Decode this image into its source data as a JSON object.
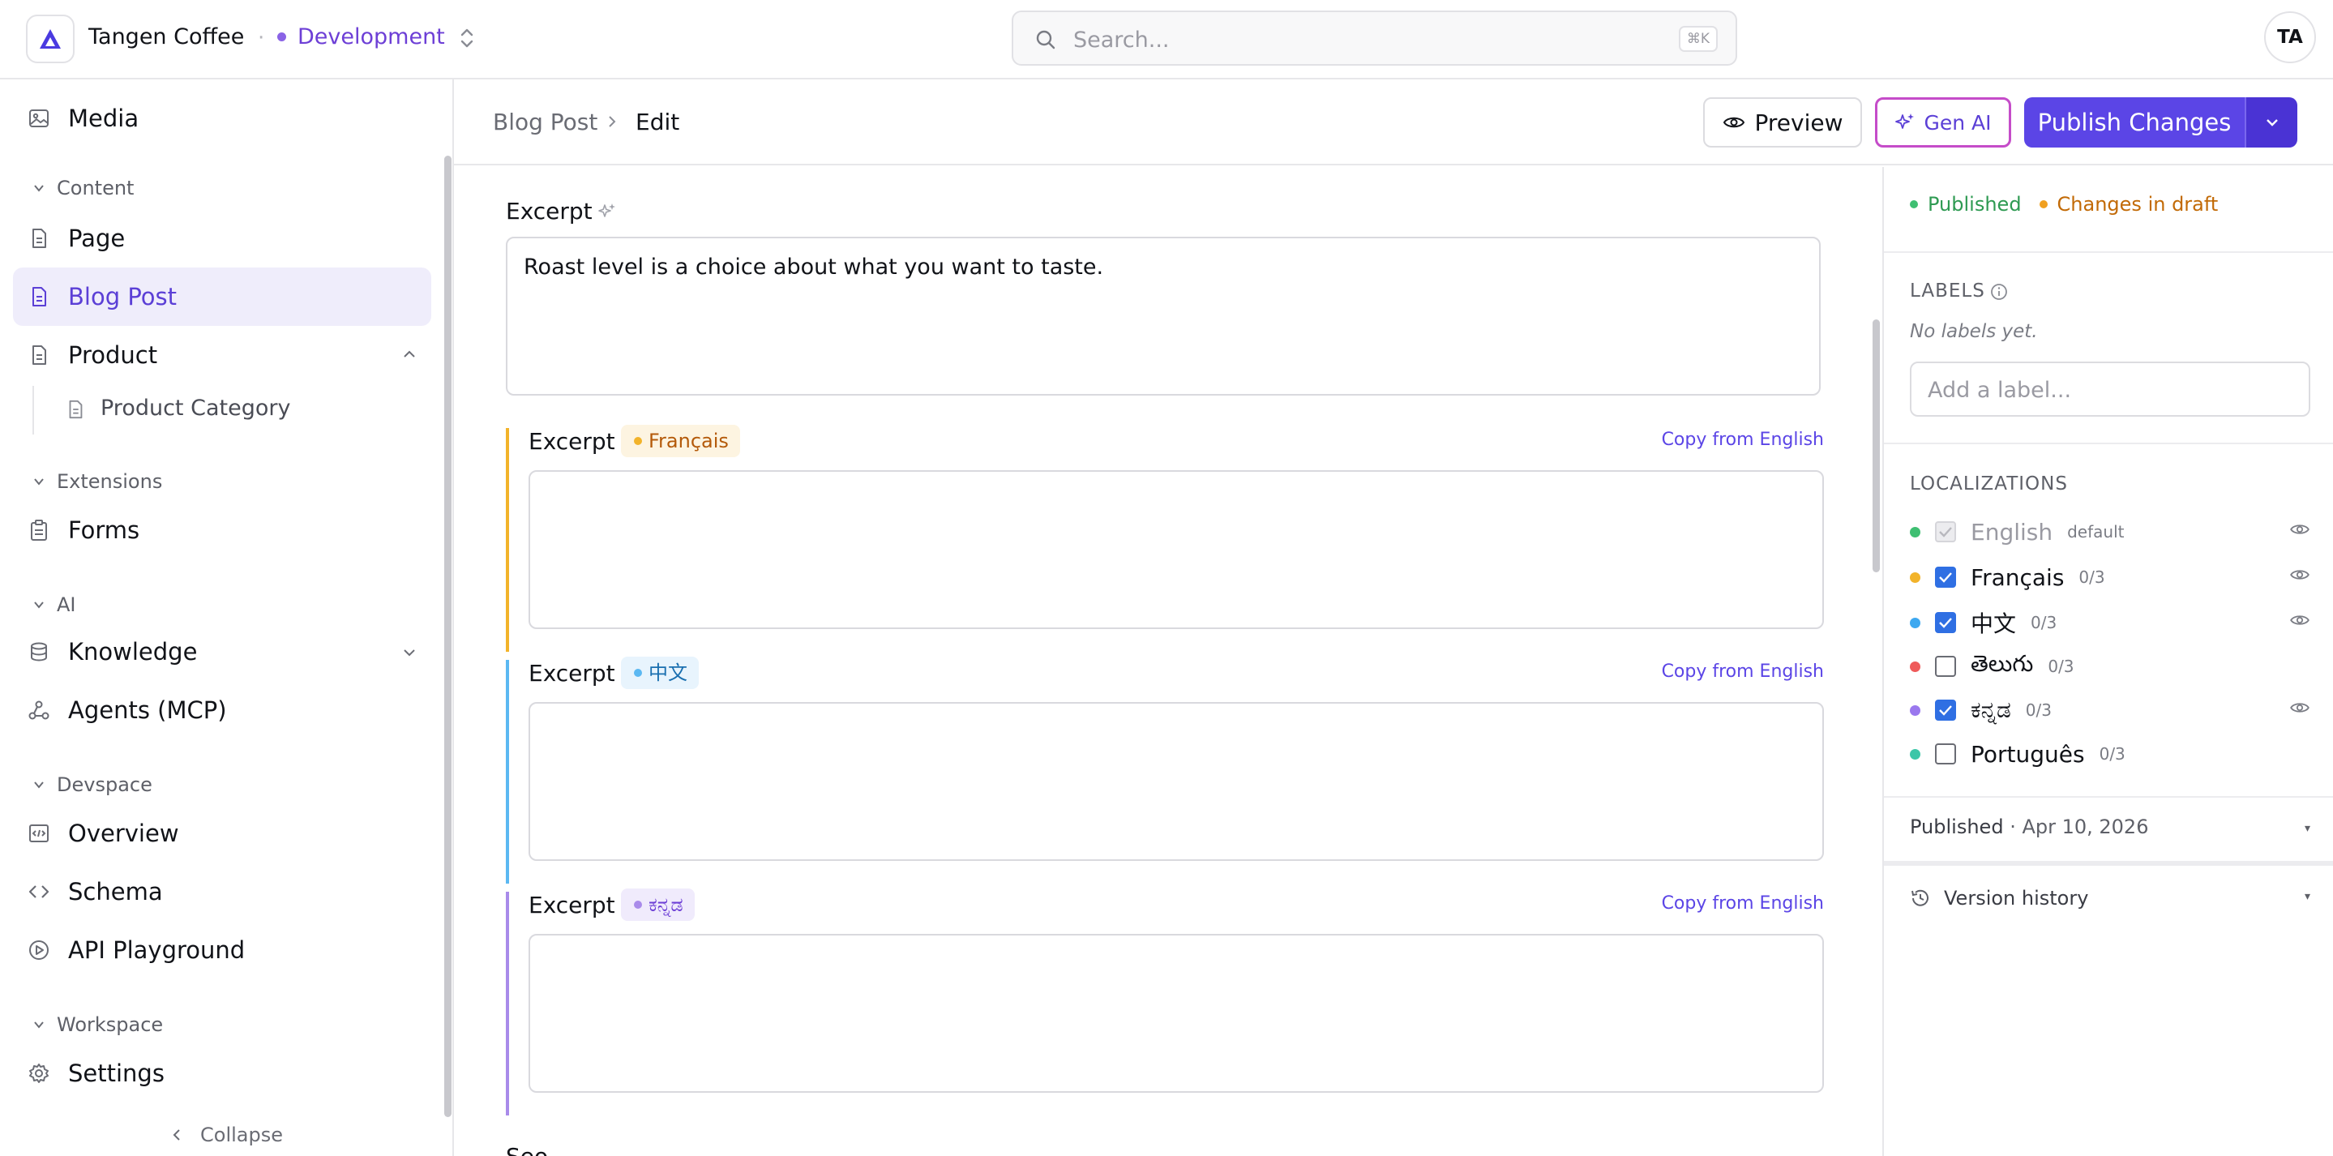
{
  "topbar": {
    "brand": "Tangen Coffee",
    "separator": "·",
    "environment": "Development",
    "search_placeholder": "Search...",
    "search_shortcut": "⌘K",
    "avatar_initials": "TA"
  },
  "sidebar": {
    "media": "Media",
    "section_content": "Content",
    "page": "Page",
    "blog_post": "Blog Post",
    "product": "Product",
    "product_category": "Product Category",
    "section_extensions": "Extensions",
    "forms": "Forms",
    "section_ai": "AI",
    "knowledge": "Knowledge",
    "agents": "Agents (MCP)",
    "section_devspace": "Devspace",
    "overview": "Overview",
    "schema": "Schema",
    "api_playground": "API Playground",
    "section_workspace": "Workspace",
    "settings": "Settings",
    "collapse": "Collapse"
  },
  "header": {
    "breadcrumb_root": "Blog Post",
    "breadcrumb_current": "Edit",
    "preview_label": "Preview",
    "genai_label": "Gen AI",
    "publish_label": "Publish Changes"
  },
  "editor": {
    "excerpt_label": "Excerpt",
    "excerpt_value": "Roast level is a choice about what you want to taste.",
    "copy_from": "Copy from English",
    "locales": [
      {
        "label": "Excerpt",
        "lang": "Français",
        "color": "#f2b32a",
        "text_color": "#b45a0a",
        "bg": "#fdf4e1"
      },
      {
        "label": "Excerpt",
        "lang": "中文",
        "color": "#5bb8f2",
        "text_color": "#1a6fb0",
        "bg": "#e8f4fd"
      },
      {
        "label": "Excerpt",
        "lang": "ಕನ್ನಡ",
        "color": "#a98bea",
        "text_color": "#6d3fd6",
        "bg": "#f0ebfc"
      }
    ],
    "next_field_partial": "Seo..."
  },
  "panel": {
    "status_published": "Published",
    "status_draft": "Changes in draft",
    "labels_heading": "LABELS",
    "labels_empty": "No labels yet.",
    "label_placeholder": "Add a label...",
    "localizations_heading": "LOCALIZATIONS",
    "localizations": [
      {
        "name": "English",
        "meta": "default",
        "checked": true,
        "disabled": true,
        "color": "#3fbf72",
        "eye": true
      },
      {
        "name": "Français",
        "meta": "0/3",
        "checked": true,
        "disabled": false,
        "color": "#f2b32a",
        "eye": true
      },
      {
        "name": "中文",
        "meta": "0/3",
        "checked": true,
        "disabled": false,
        "color": "#3da8f0",
        "eye": true
      },
      {
        "name": "తెలుగు",
        "meta": "0/3",
        "checked": false,
        "disabled": false,
        "color": "#ef5a5a",
        "eye": false
      },
      {
        "name": "ಕನ್ನಡ",
        "meta": "0/3",
        "checked": true,
        "disabled": false,
        "color": "#9a78ee",
        "eye": true
      },
      {
        "name": "Português",
        "meta": "0/3",
        "checked": false,
        "disabled": false,
        "color": "#3cc6a8",
        "eye": false
      }
    ],
    "published_label": "Published",
    "published_date": "· Apr 10, 2026",
    "version_history": "Version history"
  },
  "colors": {
    "accent": "#5b45e6",
    "published_green": "#2e9a52",
    "draft_orange": "#c26a06"
  }
}
